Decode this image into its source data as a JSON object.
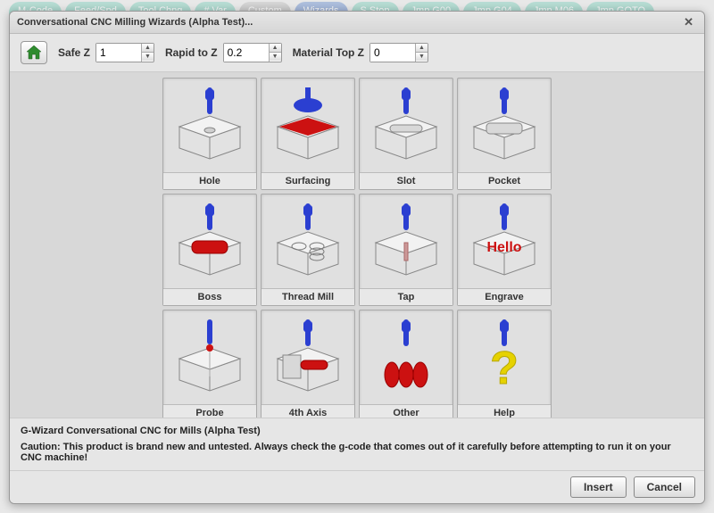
{
  "bg_tabs": [
    {
      "label": "M-Code",
      "variant": "std"
    },
    {
      "label": "Feed/Spd",
      "variant": "std"
    },
    {
      "label": "Tool Chng",
      "variant": "std"
    },
    {
      "label": "# Var",
      "variant": "std"
    },
    {
      "label": "Custom",
      "variant": "alt"
    },
    {
      "label": "Wizards",
      "variant": "wiz"
    },
    {
      "label": "S Stop",
      "variant": "std"
    },
    {
      "label": "Jmp G00",
      "variant": "std"
    },
    {
      "label": "Jmp G04",
      "variant": "std"
    },
    {
      "label": "Jmp M06",
      "variant": "std"
    },
    {
      "label": "Jmp GOTO",
      "variant": "std"
    }
  ],
  "dialog": {
    "title": "Conversational CNC Milling Wizards (Alpha Test)...",
    "close": "✕"
  },
  "params": {
    "safe_z_label": "Safe Z",
    "safe_z_value": "1",
    "rapid_label": "Rapid to Z",
    "rapid_value": "0.2",
    "mat_label": "Material Top Z",
    "mat_value": "0"
  },
  "tiles": [
    {
      "id": "hole",
      "label": "Hole"
    },
    {
      "id": "surfacing",
      "label": "Surfacing"
    },
    {
      "id": "slot",
      "label": "Slot"
    },
    {
      "id": "pocket",
      "label": "Pocket"
    },
    {
      "id": "boss",
      "label": "Boss"
    },
    {
      "id": "threadmill",
      "label": "Thread Mill"
    },
    {
      "id": "tap",
      "label": "Tap"
    },
    {
      "id": "engrave",
      "label": "Engrave"
    },
    {
      "id": "probe",
      "label": "Probe"
    },
    {
      "id": "fourthaxis",
      "label": "4th Axis"
    },
    {
      "id": "other",
      "label": "Other"
    },
    {
      "id": "help",
      "label": "Help"
    }
  ],
  "footer": {
    "heading": "G-Wizard Conversational CNC for Mills (Alpha Test)",
    "caution": "Caution: This product is brand new and untested.  Always check the g-code that comes out of it carefully before attempting to run it on your CNC machine!"
  },
  "buttons": {
    "insert": "Insert",
    "cancel": "Cancel"
  }
}
